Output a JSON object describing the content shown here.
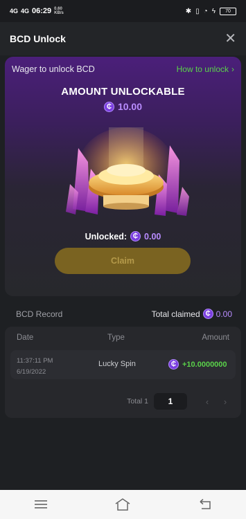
{
  "status_bar": {
    "signal_1": "4G",
    "signal_2": "4G",
    "time": "06:29",
    "speed": "0.60 KB/s",
    "battery": "70"
  },
  "header": {
    "title": "BCD Unlock",
    "close_icon": "close-icon"
  },
  "unlock_card": {
    "wager_label": "Wager to unlock BCD",
    "how_to_link": "How to unlock",
    "amount_title": "AMOUNT UNLOCKABLE",
    "amount_value": "10.00",
    "unlocked_label": "Unlocked:",
    "unlocked_value": "0.00",
    "claim_button": "Claim",
    "coin_symbol": "₵",
    "colors": {
      "accent_purple": "#b98cff",
      "link_green": "#5ad24a",
      "claim_gold": "#7a6321"
    }
  },
  "record": {
    "title": "BCD Record",
    "total_claimed_label": "Total claimed",
    "total_claimed_value": "0.00",
    "columns": [
      "Date",
      "Type",
      "Amount"
    ],
    "rows": [
      {
        "time": "11:37:11 PM",
        "date": "6/19/2022",
        "type": "Lucky Spin",
        "amount": "+10.0000000"
      }
    ],
    "pagination": {
      "total_label": "Total 1",
      "current_page": "1"
    }
  },
  "nav_bar": {
    "menu_icon": "menu-icon",
    "home_icon": "home-icon",
    "back_icon": "back-icon"
  }
}
